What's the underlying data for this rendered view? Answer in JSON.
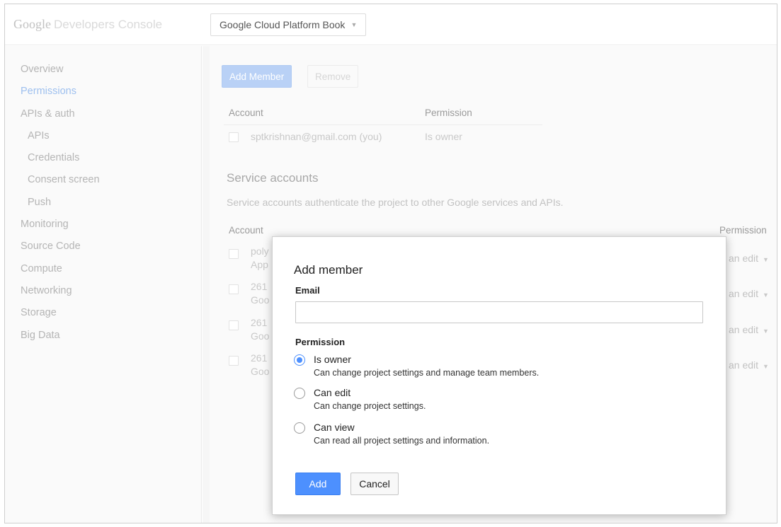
{
  "header": {
    "logo_brand": "Google",
    "logo_product": "Developers Console",
    "project_name": "Google Cloud Platform Book"
  },
  "sidebar": {
    "items": [
      {
        "label": "Overview"
      },
      {
        "label": "Permissions"
      },
      {
        "label": "APIs & auth"
      },
      {
        "label": "APIs"
      },
      {
        "label": "Credentials"
      },
      {
        "label": "Consent screen"
      },
      {
        "label": "Push"
      },
      {
        "label": "Monitoring"
      },
      {
        "label": "Source Code"
      },
      {
        "label": "Compute"
      },
      {
        "label": "Networking"
      },
      {
        "label": "Storage"
      },
      {
        "label": "Big Data"
      }
    ]
  },
  "main": {
    "add_member_label": "Add Member",
    "remove_label": "Remove",
    "members_table": {
      "col_account": "Account",
      "col_permission": "Permission",
      "rows": [
        {
          "account": "sptkrishnan@gmail.com (you)",
          "permission": "Is owner"
        }
      ]
    },
    "service_accounts": {
      "title": "Service accounts",
      "description": "Service accounts authenticate the project to other Google services and APIs.",
      "col_account": "Account",
      "col_permission": "Permission",
      "rows": [
        {
          "line1": "poly",
          "line2": "App",
          "permission": "an edit"
        },
        {
          "line1": "261",
          "line2": "Goo",
          "permission": "an edit"
        },
        {
          "line1": "261",
          "line2": "Goo",
          "permission": "an edit"
        },
        {
          "line1": "261",
          "line2": "Goo",
          "permission": "an edit"
        }
      ]
    }
  },
  "modal": {
    "title": "Add member",
    "email_label": "Email",
    "email_value": "",
    "permission_label": "Permission",
    "options": [
      {
        "label": "Is owner",
        "desc": "Can change project settings and manage team members.",
        "checked": true
      },
      {
        "label": "Can edit",
        "desc": "Can change project settings.",
        "checked": false
      },
      {
        "label": "Can view",
        "desc": "Can read all project settings and information.",
        "checked": false
      }
    ],
    "add_label": "Add",
    "cancel_label": "Cancel"
  },
  "colors": {
    "accent": "#4d90fe",
    "sidebar_active": "#9ec0ef"
  }
}
